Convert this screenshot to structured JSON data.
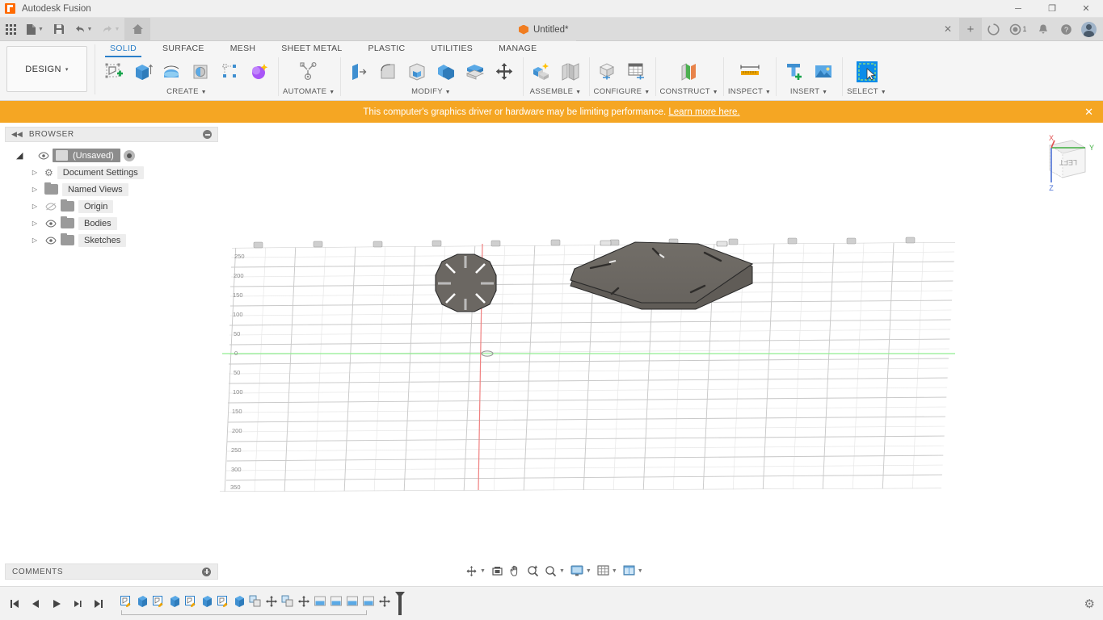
{
  "app": {
    "title": "Autodesk Fusion",
    "logo_icon": "fusion-logo-icon"
  },
  "window_controls": {
    "minimize": "─",
    "maximize": "❐",
    "close": "✕"
  },
  "quick_access": {
    "items": [
      {
        "name": "app-grid",
        "icon": "grid-icon",
        "label": ""
      },
      {
        "name": "file",
        "icon": "file-icon",
        "label": ""
      },
      {
        "name": "save",
        "icon": "save-icon",
        "label": ""
      },
      {
        "name": "undo",
        "icon": "undo-icon",
        "label": ""
      },
      {
        "name": "redo",
        "icon": "redo-icon",
        "label": ""
      },
      {
        "name": "home",
        "icon": "home-icon",
        "label": ""
      }
    ]
  },
  "document_tab": {
    "label": "Untitled*",
    "icon": "cube-icon",
    "close": "✕"
  },
  "tab_right": {
    "new_tab": "+",
    "job_status_icon": "job-status-icon",
    "recent_icon": "recent-clock-icon",
    "recent_count": "1",
    "notifications_icon": "bell-icon",
    "help_icon": "help-icon",
    "account_icon": "avatar-icon"
  },
  "workspace": {
    "label": "DESIGN",
    "caret": "▾"
  },
  "ribbon": {
    "tabs": [
      {
        "label": "SOLID",
        "active": true
      },
      {
        "label": "SURFACE",
        "active": false
      },
      {
        "label": "MESH",
        "active": false
      },
      {
        "label": "SHEET METAL",
        "active": false
      },
      {
        "label": "PLASTIC",
        "active": false
      },
      {
        "label": "UTILITIES",
        "active": false
      },
      {
        "label": "MANAGE",
        "active": false
      }
    ],
    "panels": [
      {
        "title": "CREATE",
        "has_caret": true,
        "tools": [
          "create-sketch-icon",
          "extrude-icon",
          "revolve-icon",
          "sweep-icon",
          "pattern-icon",
          "form-icon"
        ]
      },
      {
        "title": "AUTOMATE",
        "has_caret": true,
        "tools": [
          "automated-modeling-icon"
        ]
      },
      {
        "title": "MODIFY",
        "has_caret": true,
        "tools": [
          "press-pull-icon",
          "fillet-icon",
          "shell-icon",
          "combine-icon",
          "offset-face-icon",
          "move-copy-icon"
        ]
      },
      {
        "title": "ASSEMBLE",
        "has_caret": true,
        "tools": [
          "new-component-icon",
          "joint-icon"
        ]
      },
      {
        "title": "CONFIGURE",
        "has_caret": true,
        "tools": [
          "configure-model-icon",
          "configuration-table-icon"
        ]
      },
      {
        "title": "CONSTRUCT",
        "has_caret": true,
        "tools": [
          "construction-plane-icon"
        ]
      },
      {
        "title": "INSPECT",
        "has_caret": true,
        "tools": [
          "measure-icon"
        ]
      },
      {
        "title": "INSERT",
        "has_caret": true,
        "tools": [
          "insert-mcmaster-icon",
          "insert-image-icon"
        ]
      },
      {
        "title": "SELECT",
        "has_caret": true,
        "tools": [
          "select-window-icon"
        ]
      }
    ]
  },
  "banner": {
    "text": "This computer's graphics driver or hardware may be limiting performance.",
    "link": "Learn more here.",
    "close": "✕",
    "color": "#f5a623"
  },
  "browser": {
    "title": "BROWSER",
    "collapse_icon": "collapse-left-icon",
    "minimize_icon": "minimize-icon",
    "root": {
      "label": "(Unsaved)",
      "expand_arrow": "◢",
      "visibility_icon": "eye-icon",
      "document_icon": "document-icon",
      "activate_icon": "radio-on-icon"
    },
    "items": [
      {
        "label": "Document Settings",
        "icon": "gear-icon",
        "arrow": "▷",
        "eye": "none"
      },
      {
        "label": "Named Views",
        "icon": "folder-icon",
        "arrow": "▷",
        "eye": "none"
      },
      {
        "label": "Origin",
        "icon": "folder-icon",
        "arrow": "▷",
        "eye": "hidden"
      },
      {
        "label": "Bodies",
        "icon": "folder-icon",
        "arrow": "▷",
        "eye": "visible"
      },
      {
        "label": "Sketches",
        "icon": "folder-icon",
        "arrow": "▷",
        "eye": "visible"
      }
    ]
  },
  "viewport": {
    "background": "#ffffff",
    "grid_color": "#d9d9d9",
    "body_color": "#6b6762",
    "x_axis_color": "#f08080",
    "y_axis_color": "#90ee90",
    "vertical_axis_labels": [
      "250",
      "200",
      "150",
      "100",
      "50",
      "0",
      "50",
      "100",
      "150",
      "200",
      "250",
      "300",
      "350"
    ],
    "bodies": [
      {
        "name": "octagonal-slotted-plate-small",
        "shape": "octagon-with-8-slots"
      },
      {
        "name": "hexagonal-slotted-plate-large",
        "shape": "hexagon-with-slots"
      }
    ],
    "viewcube": {
      "face_label": "LEFT",
      "axis_x": "X",
      "axis_y": "Y",
      "axis_z": "Z",
      "x_color": "#e05050",
      "y_color": "#3fae3f",
      "z_color": "#4a6fd4"
    }
  },
  "navbar": {
    "items": [
      {
        "name": "orbit-icon",
        "caret": true
      },
      {
        "name": "look-at-icon",
        "caret": false
      },
      {
        "name": "pan-icon",
        "caret": false
      },
      {
        "name": "zoom-icon",
        "caret": false
      },
      {
        "name": "zoom-fit-icon",
        "caret": true
      },
      {
        "name": "display-settings-icon",
        "caret": true
      },
      {
        "name": "grid-snaps-icon",
        "caret": true
      },
      {
        "name": "viewports-icon",
        "caret": true
      }
    ]
  },
  "comments": {
    "title": "COMMENTS",
    "add_icon": "add-comment-icon"
  },
  "timeline": {
    "playback": [
      {
        "name": "go-to-beginning-icon",
        "glyph": "⏮"
      },
      {
        "name": "step-back-icon",
        "glyph": "◀"
      },
      {
        "name": "play-icon",
        "glyph": "▶"
      },
      {
        "name": "step-forward-icon",
        "glyph": "▶"
      },
      {
        "name": "go-to-end-icon",
        "glyph": "⏭"
      }
    ],
    "features": [
      "sketch-icon",
      "extrude-icon",
      "sketch-icon",
      "extrude-icon",
      "sketch-icon",
      "extrude-icon",
      "sketch-icon",
      "extrude-icon",
      "copy-paste-icon",
      "move-copy-icon",
      "copy-paste-icon",
      "move-copy-icon",
      "align-icon",
      "align-icon",
      "align-icon",
      "align-icon",
      "move-copy-icon"
    ],
    "marker_name": "timeline-playhead",
    "settings_icon": "gear-icon"
  }
}
